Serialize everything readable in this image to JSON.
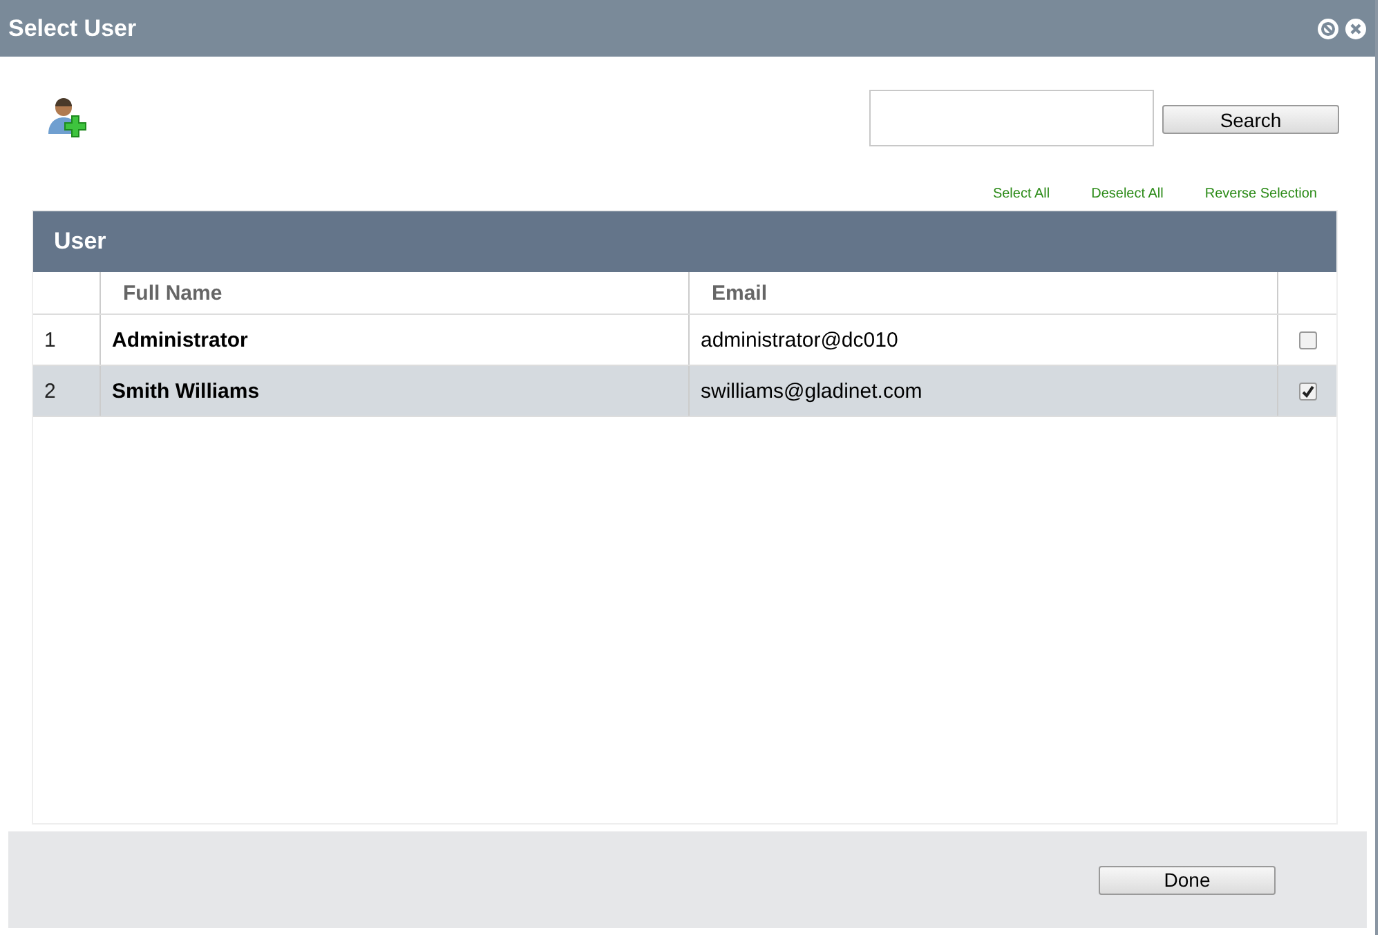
{
  "window": {
    "title": "Select User"
  },
  "search": {
    "button": "Search"
  },
  "links": [
    "Select All",
    "Deselect All",
    "Reverse Selection"
  ],
  "grid": {
    "title": "User",
    "columns": [
      "Full Name",
      "Email"
    ],
    "rows": [
      {
        "number": "1",
        "name": "Administrator",
        "email": "administrator@dc010",
        "checked": false,
        "selected": false
      },
      {
        "number": "2",
        "name": "Smith Williams",
        "email": "swilliams@gladinet.com",
        "checked": true,
        "selected": true
      }
    ]
  },
  "footer": {
    "button": "Done"
  }
}
